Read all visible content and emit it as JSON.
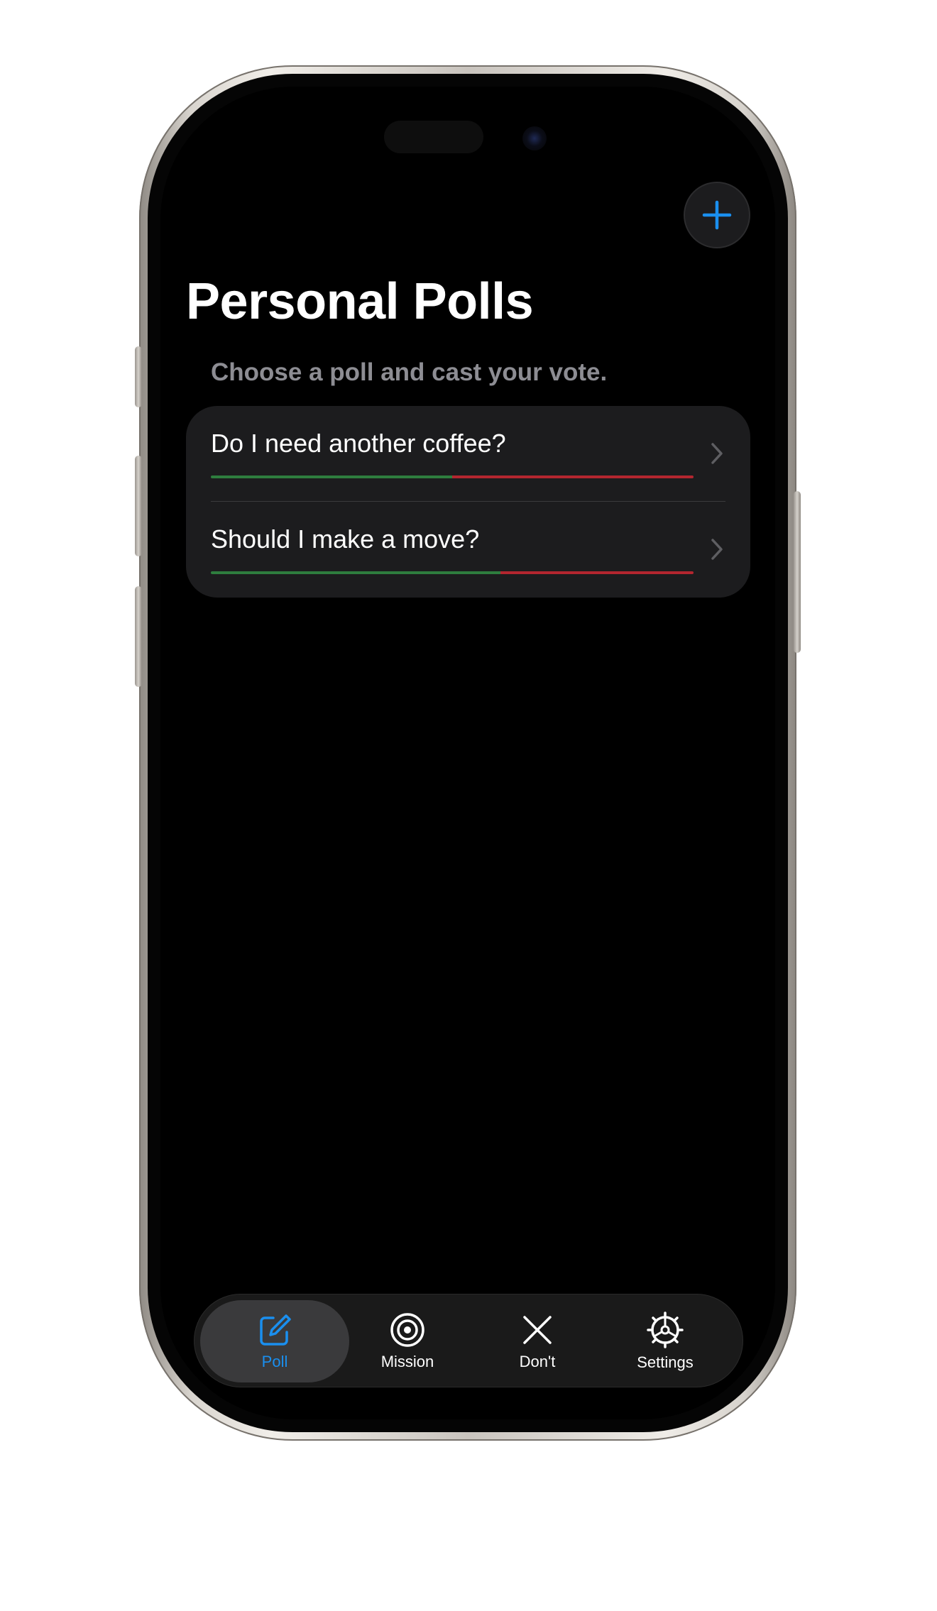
{
  "header": {
    "add_icon": "plus-icon",
    "title": "Personal Polls",
    "subtitle": "Choose a poll and cast your vote."
  },
  "polls": [
    {
      "question": "Do I need another coffee?",
      "yes_fraction": 0.5
    },
    {
      "question": "Should I make a move?",
      "yes_fraction": 0.6
    }
  ],
  "tab_bar": {
    "items": [
      {
        "label": "Poll",
        "icon": "compose-icon",
        "active": true
      },
      {
        "label": "Mission",
        "icon": "target-icon",
        "active": false
      },
      {
        "label": "Don't",
        "icon": "close-icon",
        "active": false
      },
      {
        "label": "Settings",
        "icon": "gear-icon",
        "active": false
      }
    ]
  },
  "colors": {
    "accent": "#1a8fef",
    "yes": "#2e7d3e",
    "no": "#b3262f",
    "background": "#000000",
    "card": "#1c1c1e"
  }
}
